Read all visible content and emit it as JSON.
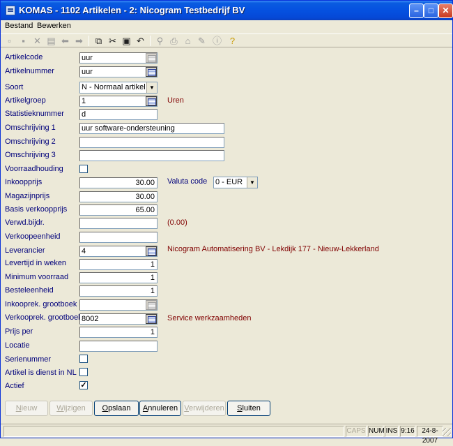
{
  "window": {
    "title": "KOMAS - 1102 Artikelen - 2: Nicogram Testbedrijf BV"
  },
  "menu": {
    "bestand": "Bestand",
    "bewerken": "Bewerken"
  },
  "fields": {
    "artikelcode": {
      "label": "Artikelcode",
      "value": "uur"
    },
    "artikelnummer": {
      "label": "Artikelnummer",
      "value": "uur"
    },
    "soort": {
      "label": "Soort",
      "value": "N - Normaal artikel"
    },
    "artikelgroep": {
      "label": "Artikelgroep",
      "value": "1",
      "info": "Uren"
    },
    "statistieknummer": {
      "label": "Statistieknummer",
      "value": "d"
    },
    "omschrijving1": {
      "label": "Omschrijving 1",
      "value": "uur software-ondersteuning"
    },
    "omschrijving2": {
      "label": "Omschrijving 2",
      "value": ""
    },
    "omschrijving3": {
      "label": "Omschrijving 3",
      "value": ""
    },
    "voorraadhouding": {
      "label": "Voorraadhouding",
      "checked": ""
    },
    "inkoopprijs": {
      "label": "Inkoopprijs",
      "value": "30.00"
    },
    "valuta_code": {
      "label": "Valuta code",
      "value": "0 - EUR"
    },
    "magazijnprijs": {
      "label": "Magazijnprijs",
      "value": "30.00"
    },
    "basis_verkoopprijs": {
      "label": "Basis verkoopprijs",
      "value": "65.00"
    },
    "verwd_bijdr": {
      "label": "Verwd.bijdr.",
      "value": "",
      "info": "(0.00)"
    },
    "verkoopeenheid": {
      "label": "Verkoopeenheid",
      "value": ""
    },
    "leverancier": {
      "label": "Leverancier",
      "value": "4",
      "info": "Nicogram Automatisering BV - Lekdijk 177 - Nieuw-Lekkerland"
    },
    "levertijd": {
      "label": "Levertijd in weken",
      "value": "1"
    },
    "minimum_voorraad": {
      "label": "Minimum voorraad",
      "value": "1"
    },
    "besteleenheid": {
      "label": "Besteleenheid",
      "value": "1"
    },
    "inkooprek_grootboek": {
      "label": "Inkooprek. grootboek",
      "value": ""
    },
    "verkooprek_grootboek": {
      "label": "Verkooprek. grootboek",
      "value": "8002",
      "info": "Service werkzaamheden"
    },
    "prijs_per": {
      "label": "Prijs per",
      "value": "1"
    },
    "locatie": {
      "label": "Locatie",
      "value": ""
    },
    "serienummer": {
      "label": "Serienummer",
      "checked": ""
    },
    "artikel_dienst": {
      "label": "Artikel is dienst in NL",
      "checked": ""
    },
    "actief": {
      "label": "Actief",
      "checked": "✓"
    }
  },
  "buttons": {
    "nieuw": {
      "acc": "N",
      "rest": "ieuw"
    },
    "wijzigen": {
      "acc": "W",
      "rest": "ijzigen"
    },
    "opslaan": {
      "acc": "O",
      "rest": "pslaan"
    },
    "annuleren": {
      "acc": "A",
      "rest": "nnuleren"
    },
    "verwijderen": {
      "acc": "V",
      "rest": "erwijderen"
    },
    "sluiten": {
      "acc": "S",
      "rest": "luiten"
    }
  },
  "status": {
    "caps": "CAPS",
    "num": "NUM",
    "ins": "INS",
    "time": "9:16",
    "date": "24-8-2007"
  },
  "icons": [
    "new-icon",
    "save-icon",
    "delete-icon",
    "print-preview-icon",
    "back-icon",
    "forward-icon",
    "copy-icon",
    "cut-icon",
    "paste-icon",
    "undo-icon",
    "find-icon",
    "print-icon",
    "bell-icon",
    "edit-icon",
    "info-icon",
    "help-icon"
  ]
}
